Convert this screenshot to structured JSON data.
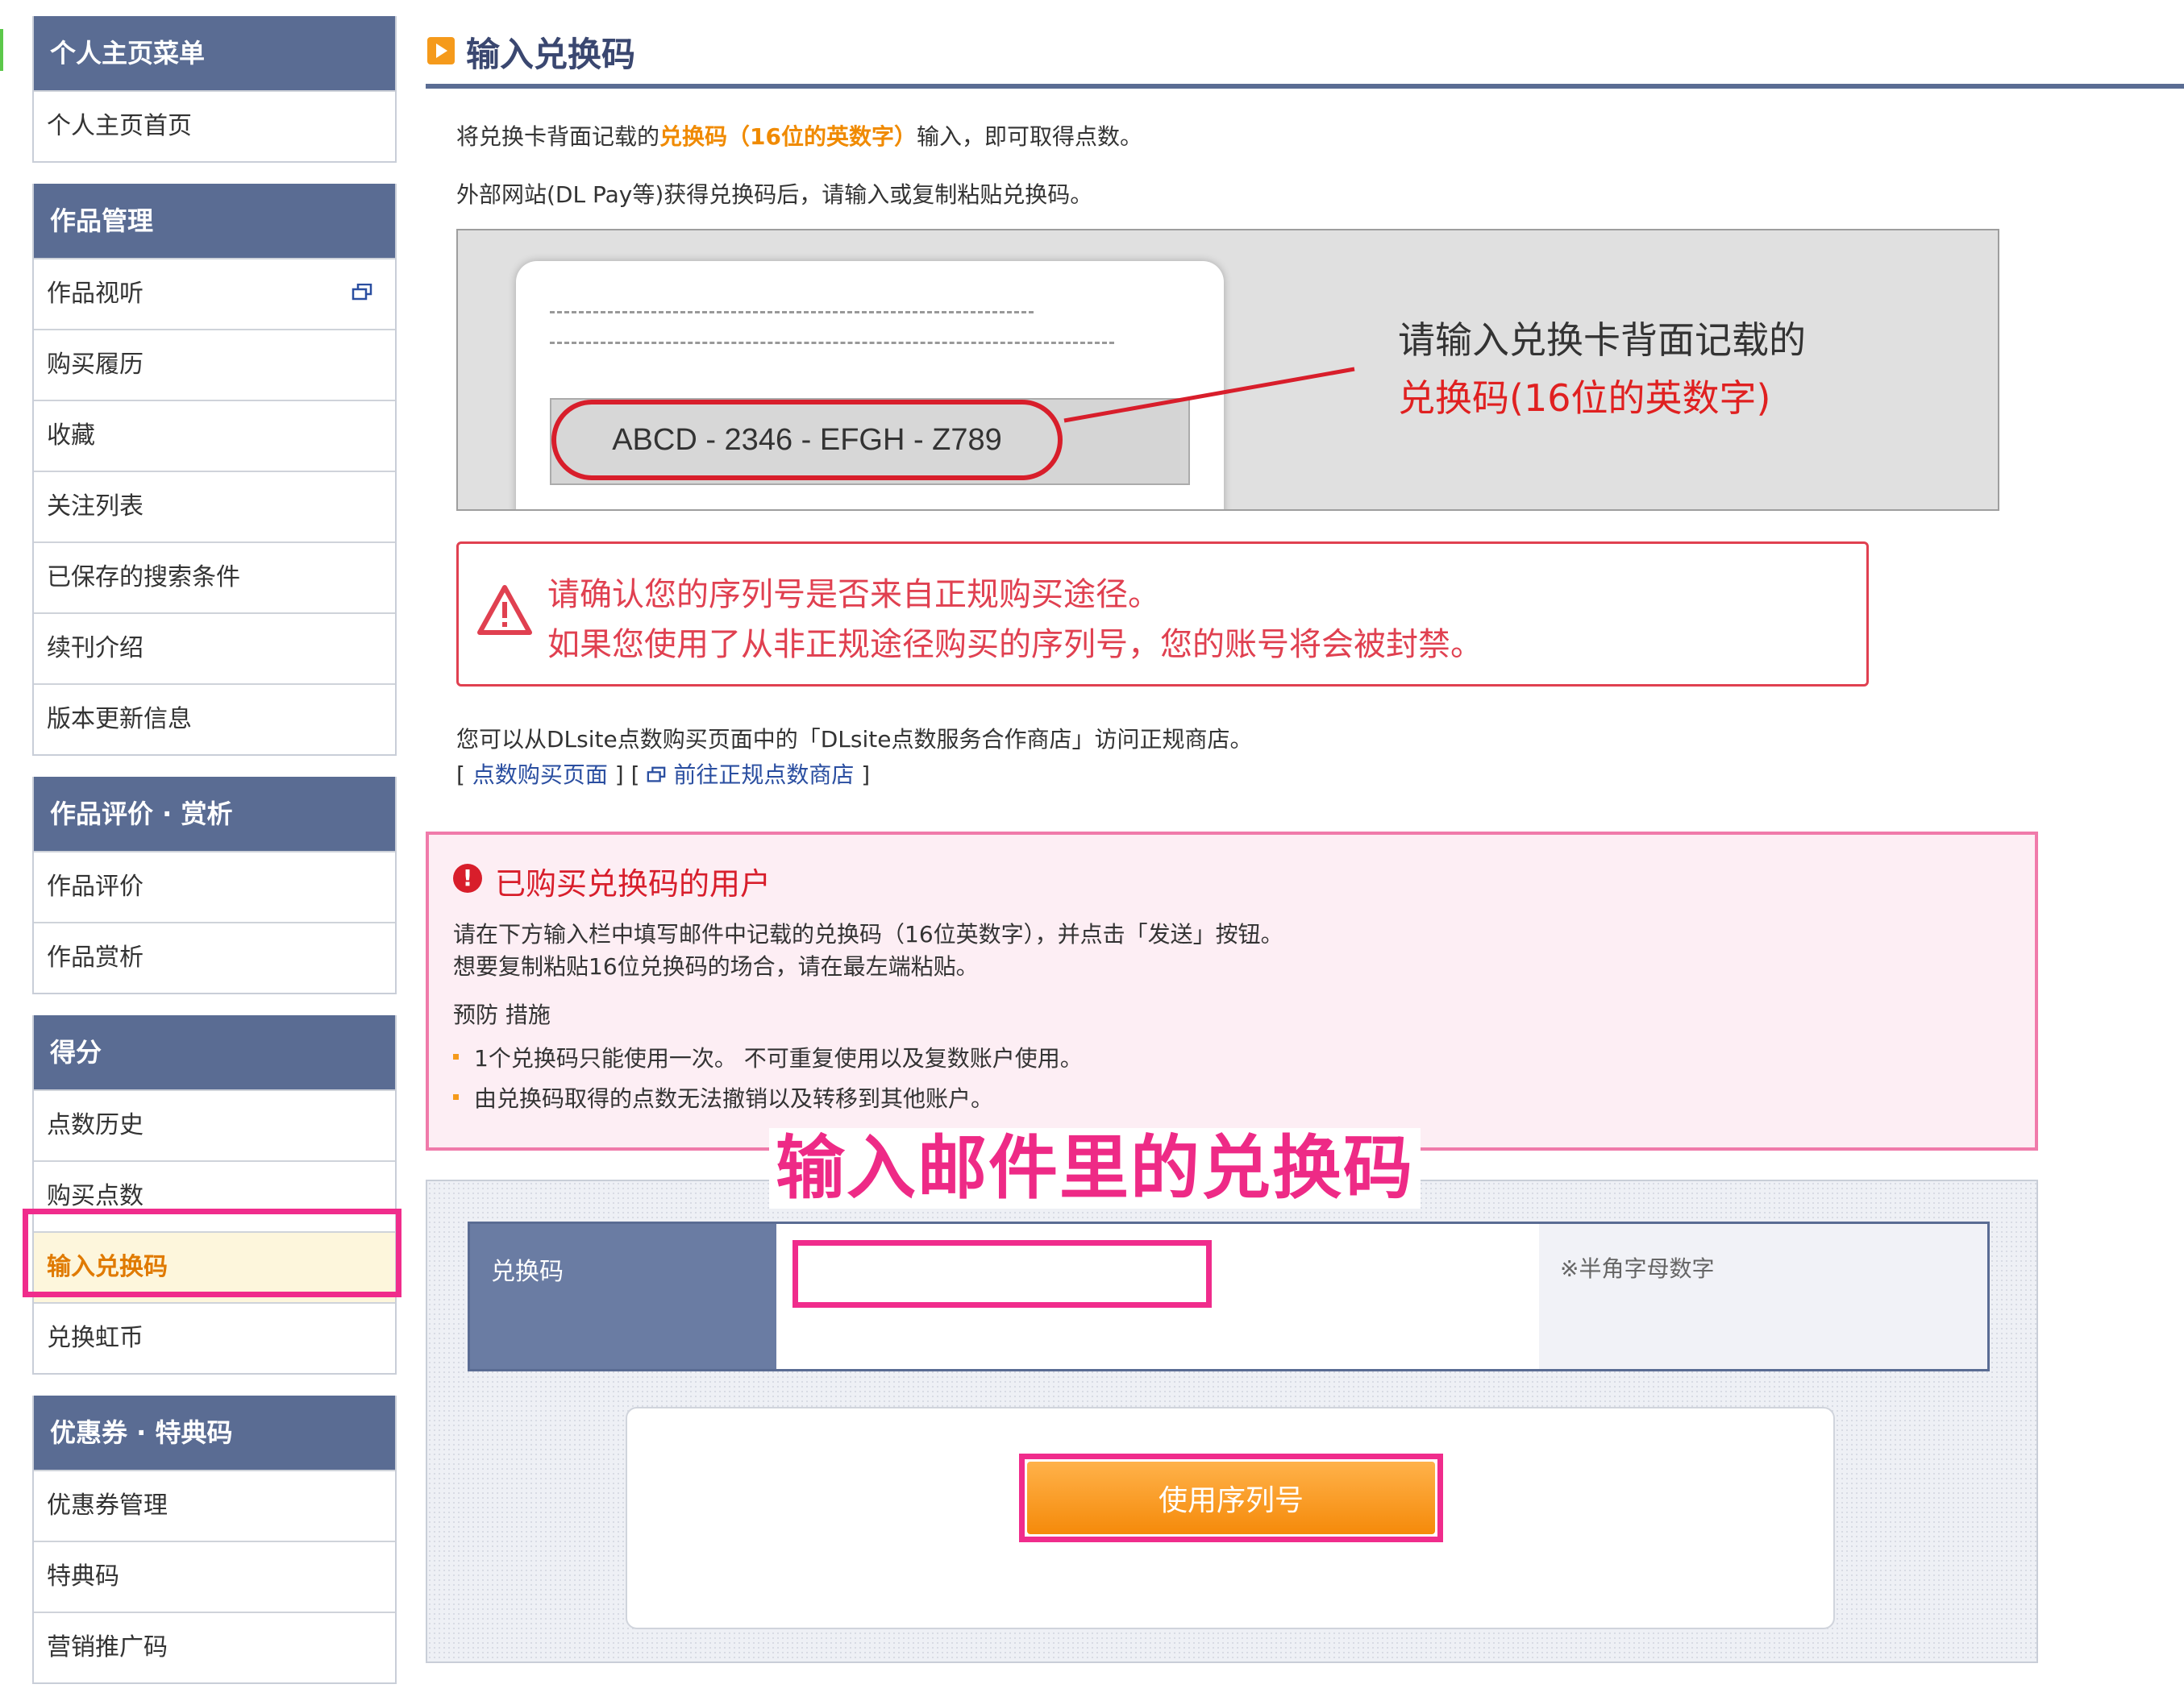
{
  "sidebar": {
    "personal": {
      "header": "个人主页菜单",
      "items": [
        "个人主页首页"
      ]
    },
    "works": {
      "header": "作品管理",
      "items": [
        "作品视听",
        "购买履历",
        "收藏",
        "关注列表",
        "已保存的搜索条件",
        "续刊介绍",
        "版本更新信息"
      ]
    },
    "review": {
      "header": "作品评价 · 赏析",
      "items": [
        "作品评价",
        "作品赏析"
      ]
    },
    "points": {
      "header": "得分",
      "items": [
        "点数历史",
        "购买点数",
        "输入兑换码",
        "兑换虹币"
      ]
    },
    "coupons": {
      "header": "优惠券 · 特典码",
      "items": [
        "优惠券管理",
        "特典码",
        "营销推广码"
      ]
    }
  },
  "main": {
    "title": "输入兑换码",
    "intro": {
      "before": "将兑换卡背面记载的",
      "highlight": "兑换码（16位的英数字）",
      "after": "输入，即可取得点数。"
    },
    "intro2": "外部网站(DL Pay等)获得兑换码后，请输入或复制粘贴兑换码。",
    "illustration": {
      "code": "ABCD - 2346 - EFGH - Z789",
      "text1": "请输入兑换卡背面记载的",
      "text2": "兑换码(16位的英数字)"
    },
    "warning": {
      "line1": "请确认您的序列号是否来自正规购买途径。",
      "line2": "如果您使用了从非正规途径购买的序列号，您的账号将会被封禁。"
    },
    "info": {
      "line1": "您可以从DLsite点数购买页面中的「DLsite点数服务合作商店」访问正规商店。",
      "link1": "点数购买页面",
      "link2": "前往正规点数商店"
    },
    "notice": {
      "title": "已购买兑换码的用户",
      "line1": "请在下方输入栏中填写邮件中记载的兑换码（16位英数字），并点击「发送」按钮。",
      "line2": "想要复制粘贴16位兑换码的场合，请在最左端粘贴。",
      "subtitle": "预防 措施",
      "bullets": [
        "1个兑换码只能使用一次。 不可重复使用以及复数账户使用。",
        "由兑换码取得的点数无法撤销以及转移到其他账户。"
      ]
    },
    "callout": "输入邮件里的兑换码",
    "form": {
      "label": "兑换码",
      "value": "",
      "note": "※半角字母数字",
      "button": "使用序列号"
    }
  },
  "colors": {
    "header_bg": "#5a6c93",
    "accent_orange": "#f59a1b",
    "warning_red": "#e04050",
    "highlight_pink": "#f02c8c"
  }
}
